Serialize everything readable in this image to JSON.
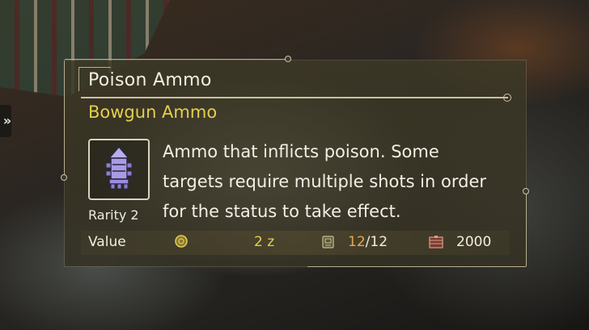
{
  "item": {
    "name": "Poison Ammo",
    "category": "Bowgun Ammo",
    "rarity_label": "Rarity 2",
    "description": "Ammo that inflicts poison. Some targets require multiple shots in order for the status to take effect.",
    "icon": "poison-ammo-icon",
    "icon_color": "#a99be3"
  },
  "value_row": {
    "label": "Value",
    "price": "2 z",
    "pouch_current": "12",
    "pouch_separator": "/",
    "pouch_max": "12",
    "box_count": "2000"
  },
  "colors": {
    "title": "#f1eee3",
    "category": "#e3cf4f",
    "pouch_current": "#e8a84a",
    "frame": "#cbc0a0"
  }
}
